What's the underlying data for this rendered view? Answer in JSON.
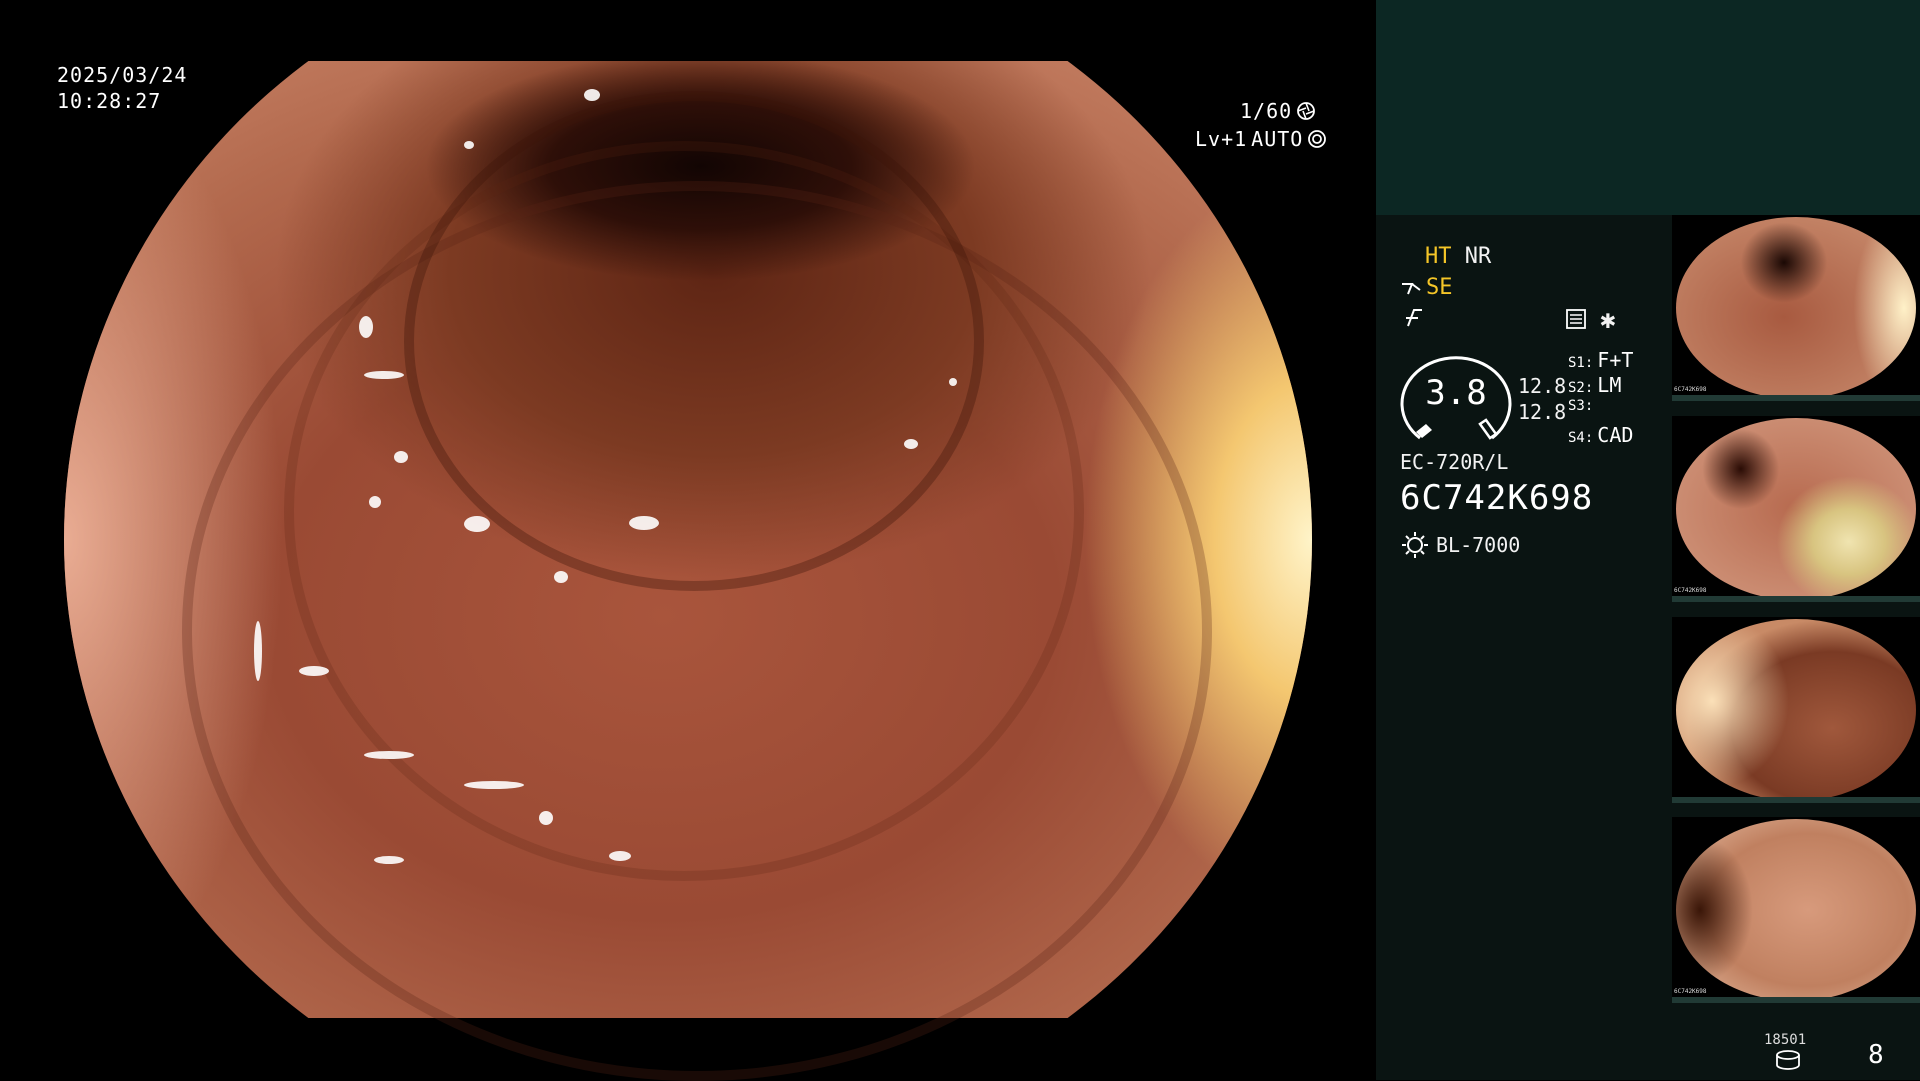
{
  "overlay": {
    "date": "2025/03/24",
    "time": "10:28:27",
    "shutter": "1/60",
    "level": "Lv+1",
    "iris": "AUTO"
  },
  "panel": {
    "mode_ht": "HT",
    "mode_nr": "NR",
    "mode_se": "SE",
    "zoom": "3.8",
    "value_a": "12.8",
    "value_b": "12.8",
    "switches": [
      {
        "key": "S1:",
        "value": "F+T"
      },
      {
        "key": "S2:",
        "value": "LM"
      },
      {
        "key": "S3:",
        "value": ""
      },
      {
        "key": "S4:",
        "value": "CAD"
      }
    ],
    "scope_model": "EC-720R/L",
    "scope_serial": "6C742K698",
    "light_source": "BL-7000",
    "storage_count": "18501",
    "image_count": "8"
  },
  "thumbnails": [
    {
      "label": "6C742K698"
    },
    {
      "label": "6C742K698"
    },
    {
      "label": ""
    },
    {
      "label": "6C742K698"
    }
  ],
  "colors": {
    "highlight": "#f5c628",
    "panel_top": "#0c2723",
    "panel_bg": "#0a1412"
  }
}
